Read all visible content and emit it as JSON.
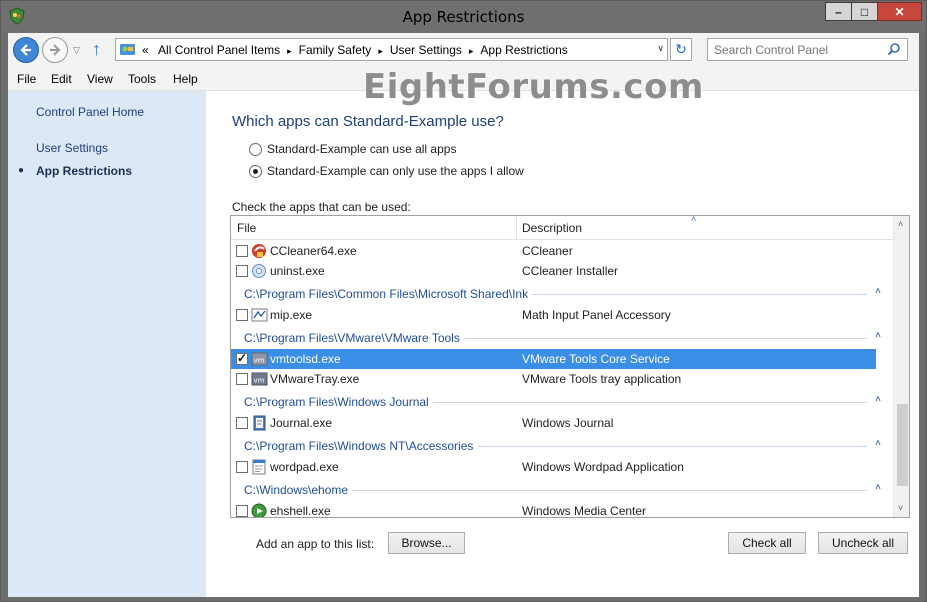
{
  "window": {
    "title": "App Restrictions",
    "controls": {
      "minimize": "–",
      "maximize": "□",
      "close": "✕"
    }
  },
  "nav": {
    "recent_arrow": "▽",
    "up_arrow": "↑",
    "breadcrumb_lead": "«",
    "breadcrumbs": [
      "All Control Panel Items",
      "Family Safety",
      "User Settings",
      "App Restrictions"
    ],
    "breadcrumb_sep": "▸",
    "dropdown_arrow": "∨",
    "refresh_glyph": "↻",
    "search_placeholder": "Search Control Panel"
  },
  "menu": [
    "File",
    "Edit",
    "View",
    "Tools",
    "Help"
  ],
  "watermark": "EightForums.com",
  "sidebar": {
    "home": "Control Panel Home",
    "user_settings": "User Settings",
    "app_restrictions": "App Restrictions",
    "bullet": "●"
  },
  "main": {
    "heading": "Which apps can Standard-Example use?",
    "radio_all": "Standard-Example can use all apps",
    "radio_allow": "Standard-Example can only use the apps I allow",
    "radio_selected": "allow",
    "check_label": "Check the apps that can be used:",
    "columns": {
      "file": "File",
      "description": "Description"
    },
    "groups": [
      {
        "path": "C:\\Program Files\\Common Files\\Microsoft Shared\\Ink"
      },
      {
        "path": "C:\\Program Files\\VMware\\VMware Tools"
      },
      {
        "path": "C:\\Program Files\\Windows Journal"
      },
      {
        "path": "C:\\Program Files\\Windows NT\\Accessories"
      },
      {
        "path": "C:\\Windows\\ehome"
      }
    ],
    "rows": [
      {
        "file": "CCleaner64.exe",
        "description": "CCleaner",
        "checked": false,
        "selected": false,
        "icon": "ccleaner-icon"
      },
      {
        "file": "uninst.exe",
        "description": "CCleaner Installer",
        "checked": false,
        "selected": false,
        "icon": "installer-icon"
      },
      {
        "file": "mip.exe",
        "description": "Math Input Panel Accessory",
        "checked": false,
        "selected": false,
        "icon": "math-input-icon"
      },
      {
        "file": "vmtoolsd.exe",
        "description": "VMware Tools Core Service",
        "checked": true,
        "selected": true,
        "icon": "vmware-icon"
      },
      {
        "file": "VMwareTray.exe",
        "description": "VMware Tools tray application",
        "checked": false,
        "selected": false,
        "icon": "vmware-icon"
      },
      {
        "file": "Journal.exe",
        "description": "Windows Journal",
        "checked": false,
        "selected": false,
        "icon": "journal-icon"
      },
      {
        "file": "wordpad.exe",
        "description": "Windows Wordpad Application",
        "checked": false,
        "selected": false,
        "icon": "wordpad-icon"
      },
      {
        "file": "ehshell.exe",
        "description": "Windows Media Center",
        "checked": false,
        "selected": false,
        "icon": "media-center-icon"
      }
    ],
    "chevron": "˄",
    "scroll_up": "˄",
    "scroll_down": "˅",
    "add_label": "Add an app to this list:",
    "browse_button": "Browse...",
    "check_all_button": "Check all",
    "uncheck_all_button": "Uncheck all"
  },
  "colors": {
    "selection": "#3a8ee6",
    "sidebar": "#dde8f6",
    "link": "#1f3f79",
    "group": "#1f4d93"
  }
}
